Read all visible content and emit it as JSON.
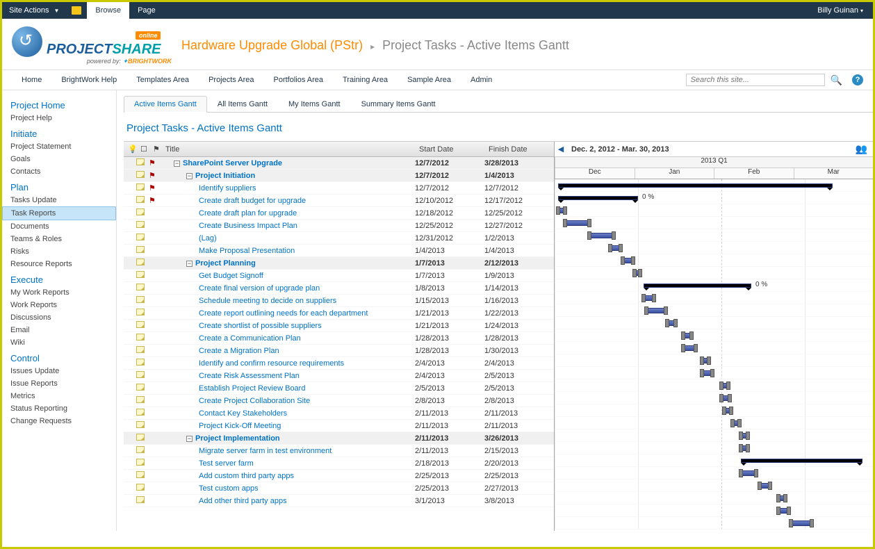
{
  "ribbon": {
    "siteActions": "Site Actions",
    "browse": "Browse",
    "page": "Page",
    "user": "Billy Guinan"
  },
  "logo": {
    "project": "PROJECT",
    "share": "SHARE",
    "online": "online",
    "powered": "powered by:",
    "bw": "BRIGHTWORK"
  },
  "breadcrumb": {
    "main": "Hardware Upgrade Global (PStr)",
    "sep": "▸",
    "sub": "Project Tasks - Active Items Gantt"
  },
  "topnav": [
    "Home",
    "BrightWork Help",
    "Templates Area",
    "Projects Area",
    "Portfolios Area",
    "Training Area",
    "Sample Area",
    "Admin"
  ],
  "search": {
    "placeholder": "Search this site..."
  },
  "sidebar": [
    {
      "head": "Project Home",
      "items": [
        "Project Help"
      ]
    },
    {
      "head": "Initiate",
      "items": [
        "Project Statement",
        "Goals",
        "Contacts"
      ]
    },
    {
      "head": "Plan",
      "items": [
        "Tasks Update",
        "Task Reports",
        "Documents",
        "Teams & Roles",
        "Risks",
        "Resource Reports"
      ]
    },
    {
      "head": "Execute",
      "items": [
        "My Work Reports",
        "Work Reports",
        "Discussions",
        "Email",
        "Wiki"
      ]
    },
    {
      "head": "Control",
      "items": [
        "Issues Update",
        "Issue Reports",
        "Metrics",
        "Status Reporting",
        "Change Requests"
      ]
    }
  ],
  "sidebarSelected": "Task Reports",
  "viewTabs": [
    "Active Items Gantt",
    "All Items Gantt",
    "My Items Gantt",
    "Summary Items Gantt"
  ],
  "pageTitle": "Project Tasks - Active Items Gantt",
  "gridHeaders": {
    "title": "Title",
    "start": "Start Date",
    "finish": "Finish Date"
  },
  "ganttHeader": {
    "range": "Dec. 2, 2012 - Mar. 30, 2013",
    "quarter": "2013 Q1",
    "months": [
      "Dec",
      "Jan",
      "Feb",
      "Mar"
    ]
  },
  "tasks": [
    {
      "title": "SharePoint Server Upgrade",
      "start": "12/7/2012",
      "finish": "3/28/2013",
      "indent": 1,
      "summary": true,
      "expand": true,
      "flag": "red",
      "note": true,
      "barL": 5,
      "barW": 395,
      "pct": ""
    },
    {
      "title": "Project Initiation",
      "start": "12/7/2012",
      "finish": "1/4/2013",
      "indent": 2,
      "summary": true,
      "expand": true,
      "flag": "red",
      "note": true,
      "barL": 5,
      "barW": 115,
      "pct": "0 %"
    },
    {
      "title": "Identify suppliers",
      "start": "12/7/2012",
      "finish": "12/7/2012",
      "indent": 3,
      "flag": "red",
      "note": true,
      "barL": 5,
      "barW": 10
    },
    {
      "title": "Create draft budget for upgrade",
      "start": "12/10/2012",
      "finish": "12/17/2012",
      "indent": 3,
      "flag": "red",
      "note": true,
      "barL": 15,
      "barW": 35
    },
    {
      "title": "Create draft plan for upgrade",
      "start": "12/18/2012",
      "finish": "12/25/2012",
      "indent": 3,
      "note": true,
      "barL": 50,
      "barW": 35
    },
    {
      "title": "Create Business Impact Plan",
      "start": "12/25/2012",
      "finish": "12/27/2012",
      "indent": 3,
      "note": true,
      "barL": 80,
      "barW": 15
    },
    {
      "title": "(Lag)",
      "start": "12/31/2012",
      "finish": "1/2/2013",
      "indent": 3,
      "note": true,
      "barL": 98,
      "barW": 15
    },
    {
      "title": "Make Proposal Presentation",
      "start": "1/4/2013",
      "finish": "1/4/2013",
      "indent": 3,
      "note": true,
      "barL": 115,
      "barW": 8
    },
    {
      "title": "Project Planning",
      "start": "1/7/2013",
      "finish": "2/12/2013",
      "indent": 2,
      "summary": true,
      "expand": true,
      "note": true,
      "barL": 128,
      "barW": 155,
      "pct": "0 %"
    },
    {
      "title": "Get Budget Signoff",
      "start": "1/7/2013",
      "finish": "1/9/2013",
      "indent": 3,
      "note": true,
      "barL": 128,
      "barW": 15
    },
    {
      "title": "Create final version of upgrade plan",
      "start": "1/8/2013",
      "finish": "1/14/2013",
      "indent": 3,
      "note": true,
      "barL": 132,
      "barW": 28
    },
    {
      "title": "Schedule meeting to decide on suppliers",
      "start": "1/15/2013",
      "finish": "1/16/2013",
      "indent": 3,
      "note": true,
      "barL": 162,
      "barW": 12
    },
    {
      "title": "Create report outlining needs for each department",
      "start": "1/21/2013",
      "finish": "1/22/2013",
      "indent": 3,
      "note": true,
      "barL": 185,
      "barW": 12
    },
    {
      "title": "Create shortlist of possible suppliers",
      "start": "1/21/2013",
      "finish": "1/24/2013",
      "indent": 3,
      "note": true,
      "barL": 185,
      "barW": 18
    },
    {
      "title": "Create a Communication Plan",
      "start": "1/28/2013",
      "finish": "1/28/2013",
      "indent": 3,
      "note": true,
      "barL": 212,
      "barW": 10
    },
    {
      "title": "Create a Migration Plan",
      "start": "1/28/2013",
      "finish": "1/30/2013",
      "indent": 3,
      "note": true,
      "barL": 212,
      "barW": 15
    },
    {
      "title": "Identify and confirm resource requirements",
      "start": "2/4/2013",
      "finish": "2/4/2013",
      "indent": 3,
      "note": true,
      "barL": 240,
      "barW": 10
    },
    {
      "title": "Create Risk Assessment Plan",
      "start": "2/4/2013",
      "finish": "2/5/2013",
      "indent": 3,
      "note": true,
      "barL": 240,
      "barW": 12
    },
    {
      "title": "Establish Project Review Board",
      "start": "2/5/2013",
      "finish": "2/5/2013",
      "indent": 3,
      "note": true,
      "barL": 244,
      "barW": 10
    },
    {
      "title": "Create Project Collaboration Site",
      "start": "2/8/2013",
      "finish": "2/8/2013",
      "indent": 3,
      "note": true,
      "barL": 256,
      "barW": 10
    },
    {
      "title": "Contact Key Stakeholders",
      "start": "2/11/2013",
      "finish": "2/11/2013",
      "indent": 3,
      "note": true,
      "barL": 268,
      "barW": 10
    },
    {
      "title": "Project Kick-Off Meeting",
      "start": "2/11/2013",
      "finish": "2/11/2013",
      "indent": 3,
      "note": true,
      "barL": 268,
      "barW": 10
    },
    {
      "title": "Project Implementation",
      "start": "2/11/2013",
      "finish": "3/26/2013",
      "indent": 2,
      "summary": true,
      "expand": true,
      "note": true,
      "barL": 268,
      "barW": 175,
      "pct": ""
    },
    {
      "title": "Migrate server farm in test environment",
      "start": "2/11/2013",
      "finish": "2/15/2013",
      "indent": 3,
      "note": true,
      "barL": 268,
      "barW": 22
    },
    {
      "title": "Test server farm",
      "start": "2/18/2013",
      "finish": "2/20/2013",
      "indent": 3,
      "note": true,
      "barL": 295,
      "barW": 15
    },
    {
      "title": "Add custom third party apps",
      "start": "2/25/2013",
      "finish": "2/25/2013",
      "indent": 3,
      "note": true,
      "barL": 322,
      "barW": 10
    },
    {
      "title": "Test custom apps",
      "start": "2/25/2013",
      "finish": "2/27/2013",
      "indent": 3,
      "note": true,
      "barL": 322,
      "barW": 15
    },
    {
      "title": "Add other third party apps",
      "start": "3/1/2013",
      "finish": "3/8/2013",
      "indent": 3,
      "note": true,
      "barL": 340,
      "barW": 30
    }
  ]
}
